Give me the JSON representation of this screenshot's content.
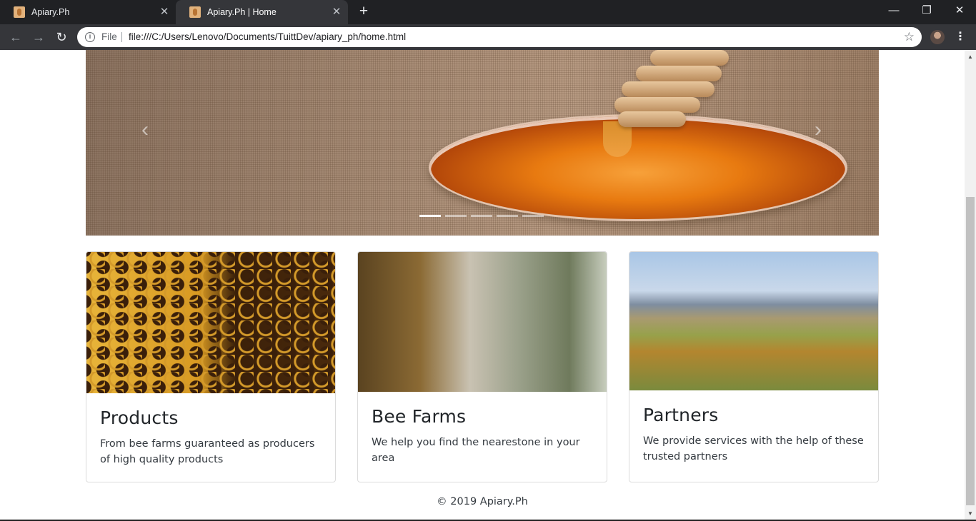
{
  "browser": {
    "tabs": [
      {
        "title": "Apiary.Ph",
        "active": false
      },
      {
        "title": "Apiary.Ph | Home",
        "active": true
      }
    ],
    "address": {
      "scheme_label": "File",
      "url": "file:///C:/Users/Lenovo/Documents/TuittDev/apiary_ph/home.html"
    },
    "icons": {
      "back": "arrow-left-icon",
      "forward": "arrow-right-icon",
      "reload": "reload-icon",
      "info": "info-icon",
      "bookmark": "star-icon",
      "menu": "kebab-menu-icon",
      "new_tab": "plus-icon",
      "minimize": "minimize-icon",
      "restore": "restore-icon",
      "close": "close-icon"
    },
    "glyphs": {
      "tab_close": "✕",
      "new_tab": "+",
      "back": "←",
      "forward": "→",
      "reload": "↻",
      "info": "i",
      "star": "☆",
      "menu": "⋮",
      "minimize": "—",
      "restore": "❐",
      "close": "✕",
      "prev": "‹",
      "next": "›",
      "scroll_up": "▲",
      "scroll_down": "▼"
    }
  },
  "carousel": {
    "slide_count": 5,
    "active_index": 0
  },
  "cards": [
    {
      "title": "Products",
      "text": "From bee farms guaranteed as producers of high quality products"
    },
    {
      "title": "Bee Farms",
      "text": "We help you find the nearestone in your area"
    },
    {
      "title": "Partners",
      "text": "We provide services with the help of these trusted partners"
    }
  ],
  "footer": {
    "text": "© 2019 Apiary.Ph"
  },
  "colors": {
    "chrome_dark": "#202124",
    "toolbar": "#35363a",
    "honey": "#e87a10",
    "text": "#212529"
  }
}
